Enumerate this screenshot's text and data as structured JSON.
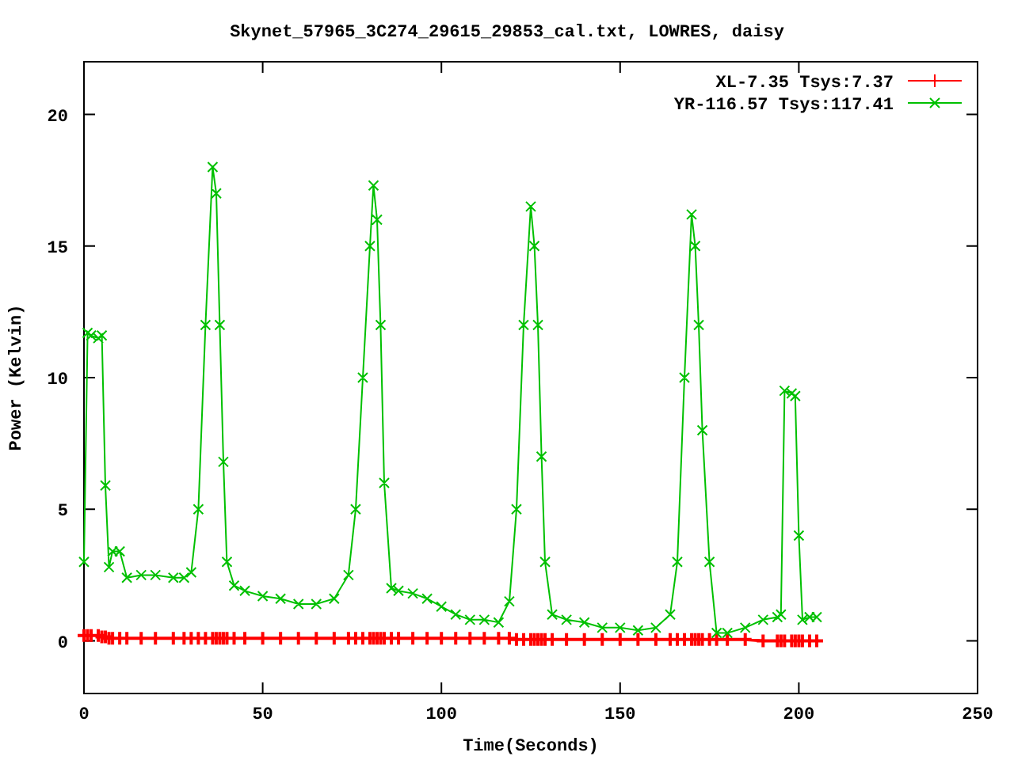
{
  "chart_data": {
    "type": "line",
    "title": "Skynet_57965_3C274_29615_29853_cal.txt, LOWRES, daisy",
    "xlabel": "Time(Seconds)",
    "ylabel": "Power (Kelvin)",
    "x": [
      0,
      1,
      2,
      4,
      5,
      6,
      7,
      8,
      10,
      12,
      16,
      20,
      25,
      28,
      30,
      32,
      34,
      36,
      37,
      38,
      39,
      40,
      42,
      45,
      50,
      55,
      60,
      65,
      70,
      74,
      76,
      78,
      80,
      81,
      82,
      83,
      84,
      86,
      88,
      92,
      96,
      100,
      104,
      108,
      112,
      116,
      119,
      121,
      123,
      125,
      126,
      127,
      128,
      129,
      131,
      135,
      140,
      145,
      150,
      155,
      160,
      164,
      166,
      168,
      170,
      171,
      172,
      173,
      175,
      177,
      180,
      185,
      190,
      194,
      195,
      196,
      198,
      199,
      200,
      201,
      203,
      205
    ],
    "series": [
      {
        "name": "XL-7.35 Tsys:7.37",
        "color": "#ff0000",
        "marker": "cross",
        "values": [
          0.2,
          0.2,
          0.2,
          0.2,
          0.15,
          0.15,
          0.1,
          0.1,
          0.1,
          0.1,
          0.1,
          0.1,
          0.1,
          0.1,
          0.1,
          0.1,
          0.1,
          0.1,
          0.1,
          0.1,
          0.1,
          0.1,
          0.1,
          0.1,
          0.1,
          0.1,
          0.1,
          0.1,
          0.1,
          0.1,
          0.1,
          0.1,
          0.1,
          0.1,
          0.1,
          0.1,
          0.1,
          0.1,
          0.1,
          0.1,
          0.1,
          0.1,
          0.1,
          0.1,
          0.1,
          0.1,
          0.1,
          0.05,
          0.05,
          0.05,
          0.05,
          0.05,
          0.05,
          0.05,
          0.05,
          0.05,
          0.05,
          0.05,
          0.05,
          0.05,
          0.05,
          0.05,
          0.05,
          0.05,
          0.05,
          0.05,
          0.05,
          0.05,
          0.05,
          0.05,
          0.05,
          0.05,
          0,
          0,
          0,
          0,
          0,
          0,
          0,
          0,
          0,
          0
        ]
      },
      {
        "name": "YR-116.57 Tsys:117.41",
        "color": "#00c000",
        "marker": "cross",
        "values": [
          3,
          11.7,
          11.6,
          11.5,
          11.6,
          5.9,
          2.8,
          3.4,
          3.4,
          2.4,
          2.5,
          2.5,
          2.4,
          2.4,
          2.6,
          5,
          12,
          18,
          17,
          12,
          6.8,
          3,
          2.1,
          1.9,
          1.7,
          1.6,
          1.4,
          1.4,
          1.6,
          2.5,
          5,
          10,
          15,
          17.3,
          16,
          12,
          6,
          2,
          1.9,
          1.8,
          1.6,
          1.3,
          1,
          0.8,
          0.8,
          0.7,
          1.5,
          5,
          12,
          16.5,
          15,
          12,
          7,
          3,
          1,
          0.8,
          0.7,
          0.5,
          0.5,
          0.4,
          0.5,
          1,
          3,
          10,
          16.2,
          15,
          12,
          8,
          3,
          0.3,
          0.3,
          0.5,
          0.8,
          0.9,
          1,
          9.5,
          9.4,
          9.3,
          4,
          0.8,
          0.9,
          0.9
        ]
      }
    ],
    "legend": true,
    "xlim": [
      0,
      250
    ],
    "ylim": [
      -2,
      22
    ],
    "xticks": [
      0,
      50,
      100,
      150,
      200,
      250
    ],
    "yticks": [
      0,
      5,
      10,
      15,
      20
    ]
  }
}
